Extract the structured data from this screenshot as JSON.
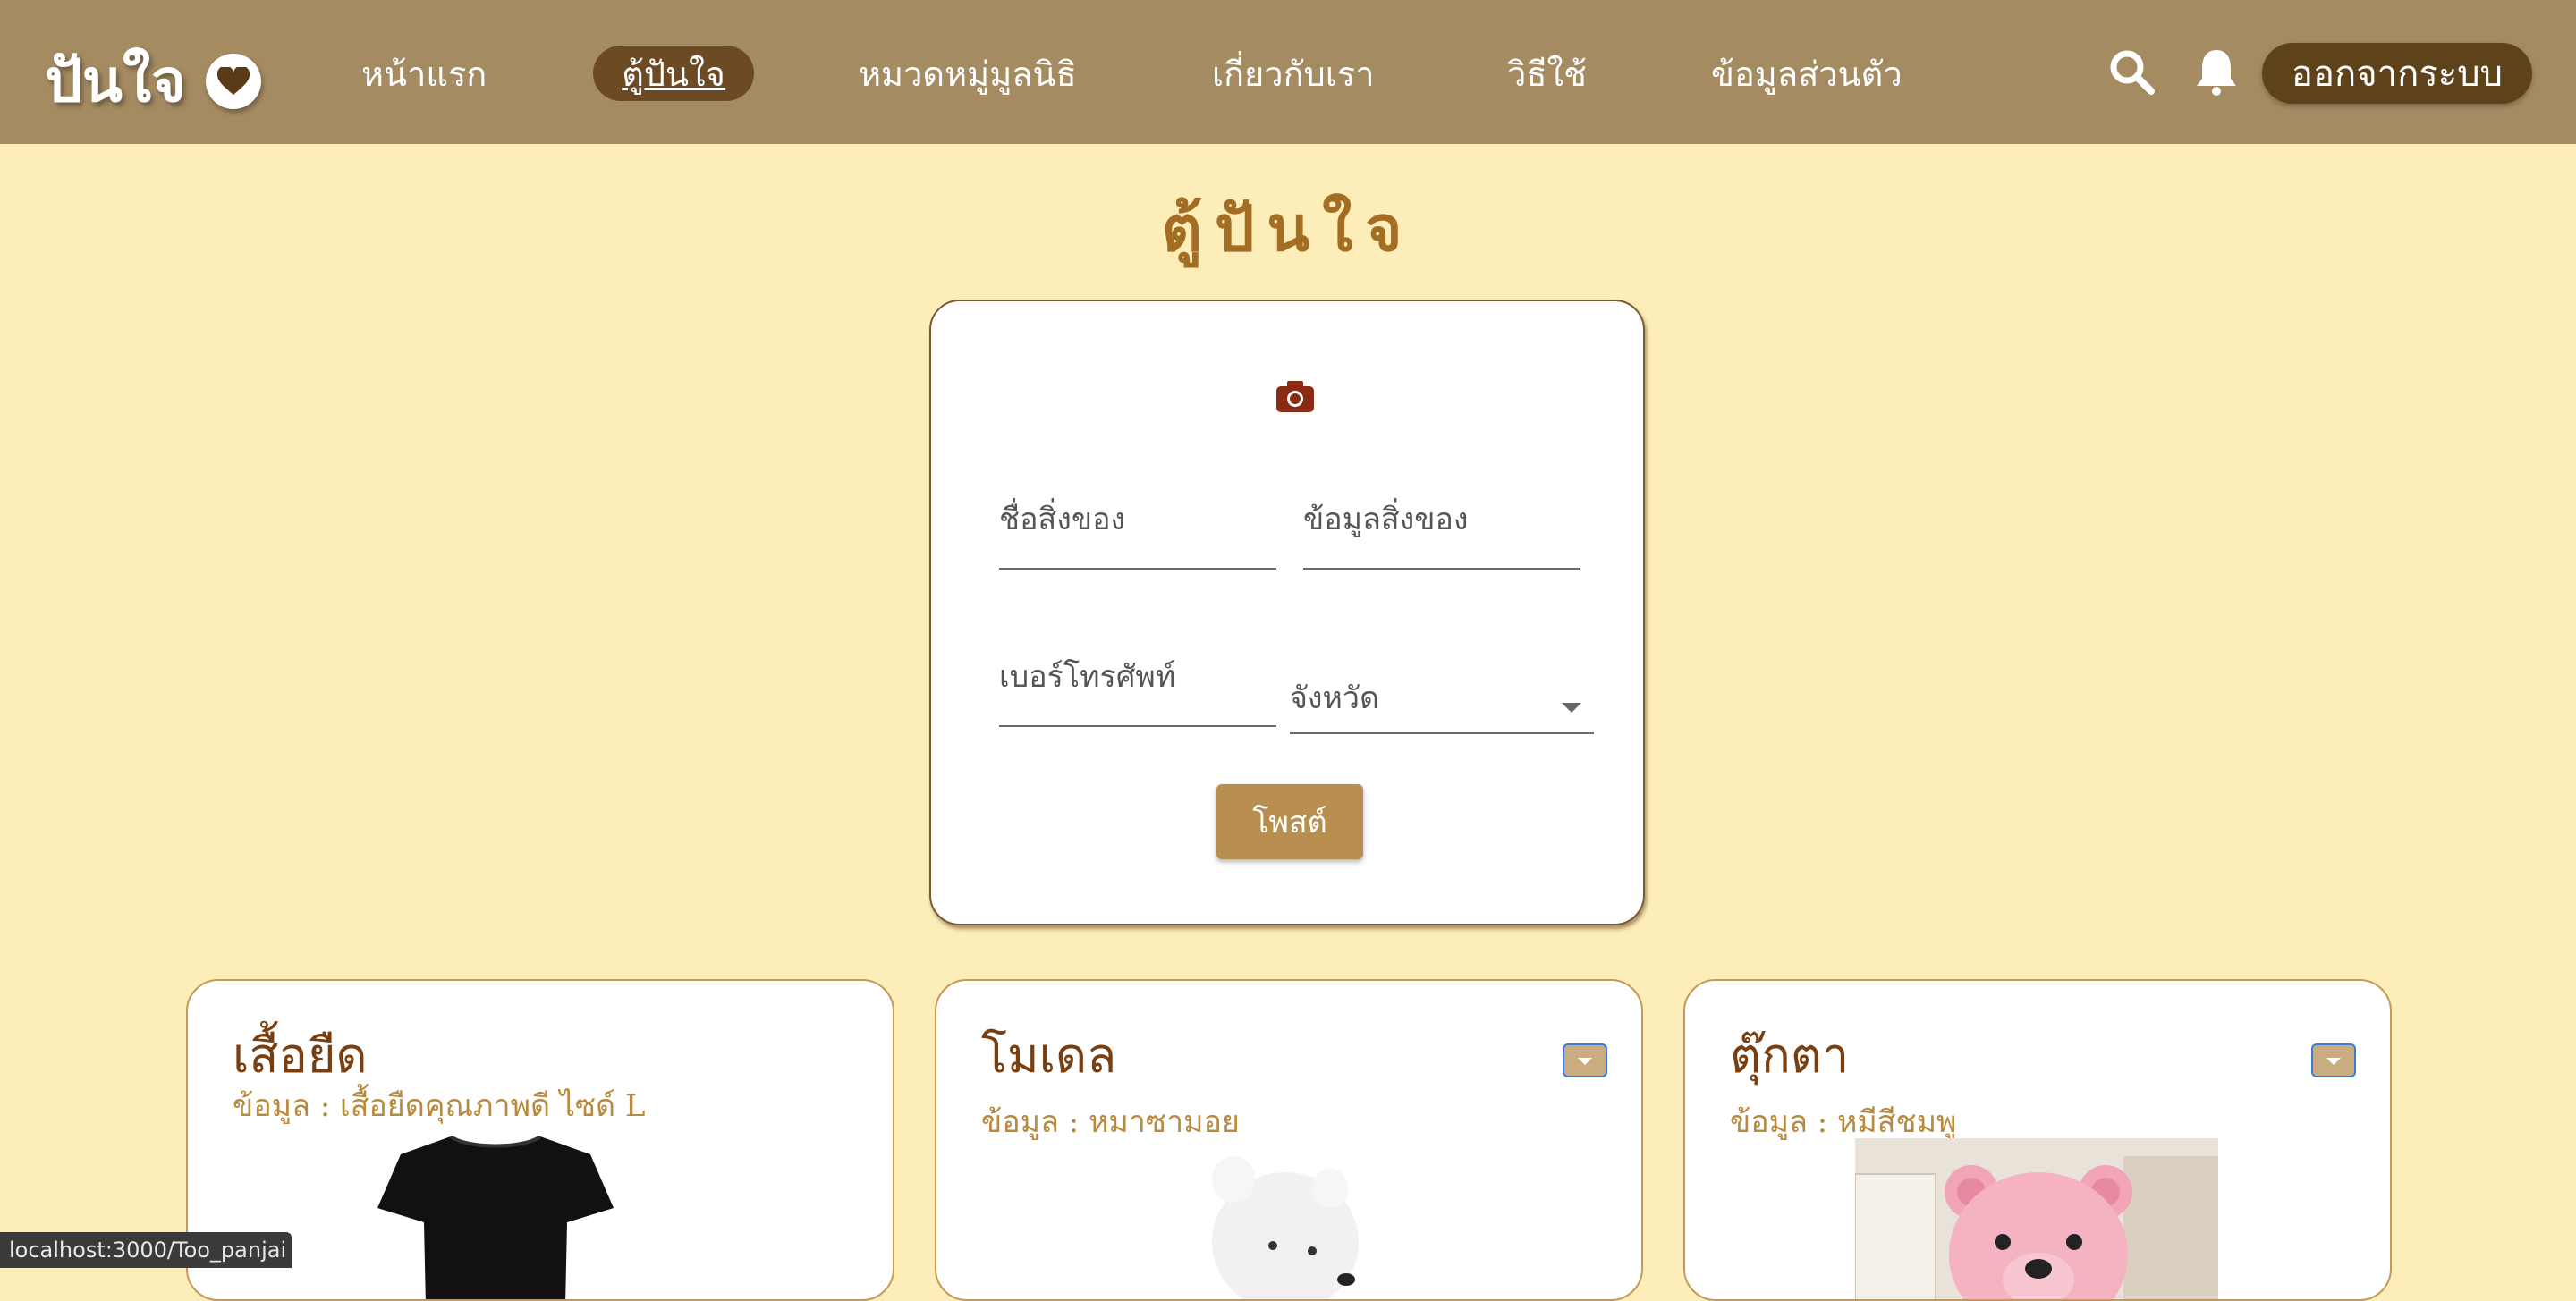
{
  "nav": {
    "brand": "ปันใจ",
    "items": [
      "หน้าแรก",
      "ตู้ปันใจ",
      "หมวดหมู่มูลนิธิ",
      "เกี่ยวกับเรา",
      "วิธีใช้",
      "ข้อมูลส่วนตัว"
    ],
    "active_index": 1,
    "logout_label": "ออกจากระบบ"
  },
  "page": {
    "title": "ตู้ปันใจ"
  },
  "form": {
    "item_name_label": "ชื่อสิ่งของ",
    "item_info_label": "ข้อมูลสิ่งของ",
    "phone_label": "เบอร์โทรศัพท์",
    "province_label": "จังหวัด",
    "post_label": "โพสต์"
  },
  "items": [
    {
      "title": "เสื้อยืด",
      "info": "ข้อมูล : เสื้อยืดคุณภาพดี ไซด์ L"
    },
    {
      "title": "โมเดล",
      "info": "ข้อมูล : หมาซามอย"
    },
    {
      "title": "ตุ๊กตา",
      "info": "ข้อมูล : หมีสีชมพู"
    }
  ],
  "status_url": "localhost:3000/Too_panjai",
  "colors": {
    "navbar": "#a58b62",
    "background": "#fdedb8",
    "accent": "#b98f50",
    "title": "#a36d23"
  },
  "icons": [
    "heart-icon",
    "search-icon",
    "bell-icon",
    "camera-icon",
    "chevron-down-icon"
  ]
}
